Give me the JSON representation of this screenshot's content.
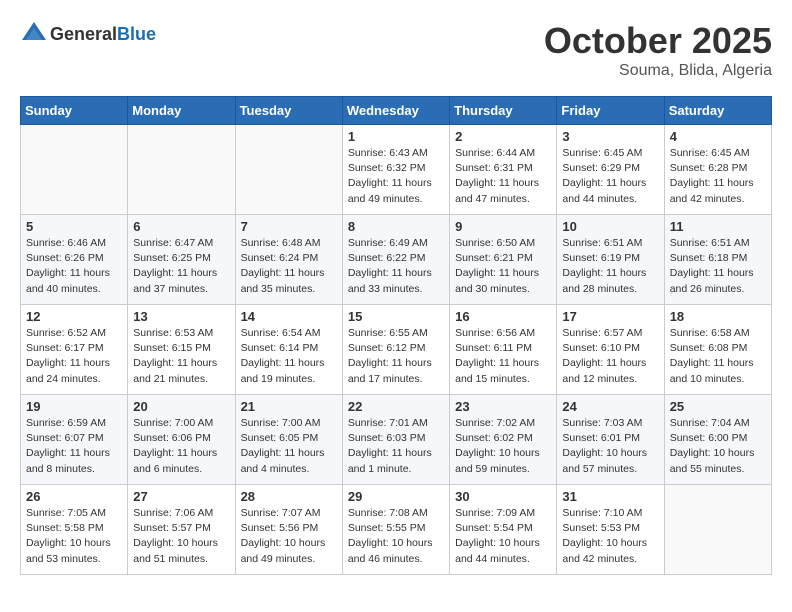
{
  "header": {
    "logo_general": "General",
    "logo_blue": "Blue",
    "month_title": "October 2025",
    "location": "Souma, Blida, Algeria"
  },
  "days_of_week": [
    "Sunday",
    "Monday",
    "Tuesday",
    "Wednesday",
    "Thursday",
    "Friday",
    "Saturday"
  ],
  "weeks": [
    [
      {
        "day": "",
        "info": ""
      },
      {
        "day": "",
        "info": ""
      },
      {
        "day": "",
        "info": ""
      },
      {
        "day": "1",
        "info": "Sunrise: 6:43 AM\nSunset: 6:32 PM\nDaylight: 11 hours\nand 49 minutes."
      },
      {
        "day": "2",
        "info": "Sunrise: 6:44 AM\nSunset: 6:31 PM\nDaylight: 11 hours\nand 47 minutes."
      },
      {
        "day": "3",
        "info": "Sunrise: 6:45 AM\nSunset: 6:29 PM\nDaylight: 11 hours\nand 44 minutes."
      },
      {
        "day": "4",
        "info": "Sunrise: 6:45 AM\nSunset: 6:28 PM\nDaylight: 11 hours\nand 42 minutes."
      }
    ],
    [
      {
        "day": "5",
        "info": "Sunrise: 6:46 AM\nSunset: 6:26 PM\nDaylight: 11 hours\nand 40 minutes."
      },
      {
        "day": "6",
        "info": "Sunrise: 6:47 AM\nSunset: 6:25 PM\nDaylight: 11 hours\nand 37 minutes."
      },
      {
        "day": "7",
        "info": "Sunrise: 6:48 AM\nSunset: 6:24 PM\nDaylight: 11 hours\nand 35 minutes."
      },
      {
        "day": "8",
        "info": "Sunrise: 6:49 AM\nSunset: 6:22 PM\nDaylight: 11 hours\nand 33 minutes."
      },
      {
        "day": "9",
        "info": "Sunrise: 6:50 AM\nSunset: 6:21 PM\nDaylight: 11 hours\nand 30 minutes."
      },
      {
        "day": "10",
        "info": "Sunrise: 6:51 AM\nSunset: 6:19 PM\nDaylight: 11 hours\nand 28 minutes."
      },
      {
        "day": "11",
        "info": "Sunrise: 6:51 AM\nSunset: 6:18 PM\nDaylight: 11 hours\nand 26 minutes."
      }
    ],
    [
      {
        "day": "12",
        "info": "Sunrise: 6:52 AM\nSunset: 6:17 PM\nDaylight: 11 hours\nand 24 minutes."
      },
      {
        "day": "13",
        "info": "Sunrise: 6:53 AM\nSunset: 6:15 PM\nDaylight: 11 hours\nand 21 minutes."
      },
      {
        "day": "14",
        "info": "Sunrise: 6:54 AM\nSunset: 6:14 PM\nDaylight: 11 hours\nand 19 minutes."
      },
      {
        "day": "15",
        "info": "Sunrise: 6:55 AM\nSunset: 6:12 PM\nDaylight: 11 hours\nand 17 minutes."
      },
      {
        "day": "16",
        "info": "Sunrise: 6:56 AM\nSunset: 6:11 PM\nDaylight: 11 hours\nand 15 minutes."
      },
      {
        "day": "17",
        "info": "Sunrise: 6:57 AM\nSunset: 6:10 PM\nDaylight: 11 hours\nand 12 minutes."
      },
      {
        "day": "18",
        "info": "Sunrise: 6:58 AM\nSunset: 6:08 PM\nDaylight: 11 hours\nand 10 minutes."
      }
    ],
    [
      {
        "day": "19",
        "info": "Sunrise: 6:59 AM\nSunset: 6:07 PM\nDaylight: 11 hours\nand 8 minutes."
      },
      {
        "day": "20",
        "info": "Sunrise: 7:00 AM\nSunset: 6:06 PM\nDaylight: 11 hours\nand 6 minutes."
      },
      {
        "day": "21",
        "info": "Sunrise: 7:00 AM\nSunset: 6:05 PM\nDaylight: 11 hours\nand 4 minutes."
      },
      {
        "day": "22",
        "info": "Sunrise: 7:01 AM\nSunset: 6:03 PM\nDaylight: 11 hours\nand 1 minute."
      },
      {
        "day": "23",
        "info": "Sunrise: 7:02 AM\nSunset: 6:02 PM\nDaylight: 10 hours\nand 59 minutes."
      },
      {
        "day": "24",
        "info": "Sunrise: 7:03 AM\nSunset: 6:01 PM\nDaylight: 10 hours\nand 57 minutes."
      },
      {
        "day": "25",
        "info": "Sunrise: 7:04 AM\nSunset: 6:00 PM\nDaylight: 10 hours\nand 55 minutes."
      }
    ],
    [
      {
        "day": "26",
        "info": "Sunrise: 7:05 AM\nSunset: 5:58 PM\nDaylight: 10 hours\nand 53 minutes."
      },
      {
        "day": "27",
        "info": "Sunrise: 7:06 AM\nSunset: 5:57 PM\nDaylight: 10 hours\nand 51 minutes."
      },
      {
        "day": "28",
        "info": "Sunrise: 7:07 AM\nSunset: 5:56 PM\nDaylight: 10 hours\nand 49 minutes."
      },
      {
        "day": "29",
        "info": "Sunrise: 7:08 AM\nSunset: 5:55 PM\nDaylight: 10 hours\nand 46 minutes."
      },
      {
        "day": "30",
        "info": "Sunrise: 7:09 AM\nSunset: 5:54 PM\nDaylight: 10 hours\nand 44 minutes."
      },
      {
        "day": "31",
        "info": "Sunrise: 7:10 AM\nSunset: 5:53 PM\nDaylight: 10 hours\nand 42 minutes."
      },
      {
        "day": "",
        "info": ""
      }
    ]
  ]
}
